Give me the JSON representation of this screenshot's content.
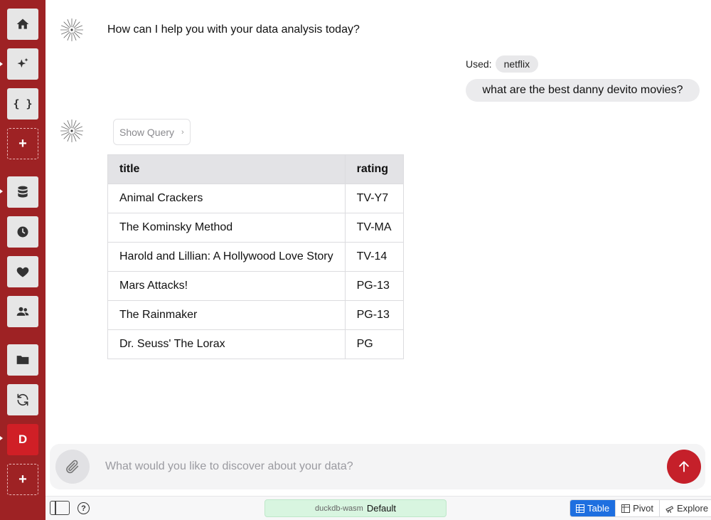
{
  "sidebar": {
    "items": [
      {
        "name": "home",
        "icon": "home-icon"
      },
      {
        "name": "ai",
        "icon": "sparkles-icon"
      },
      {
        "name": "code",
        "icon": "braces-icon",
        "glyph": "{ }"
      },
      {
        "name": "add-top",
        "icon": "plus-icon",
        "glyph": "+"
      },
      {
        "name": "database",
        "icon": "database-icon"
      },
      {
        "name": "history",
        "icon": "clock-icon"
      },
      {
        "name": "favorites",
        "icon": "heart-icon"
      },
      {
        "name": "team",
        "icon": "users-icon"
      },
      {
        "name": "files",
        "icon": "folder-icon"
      },
      {
        "name": "sync",
        "icon": "refresh-icon"
      },
      {
        "name": "default-db",
        "icon": "database-letter",
        "glyph": "D"
      },
      {
        "name": "add-bottom",
        "icon": "plus-icon",
        "glyph": "+"
      }
    ]
  },
  "chat": {
    "assistant_greeting": "How can I help you with your data analysis today?",
    "used_label": "Used:",
    "used_dataset": "netflix",
    "user_message": "what are the best danny devito movies?",
    "show_query_label": "Show Query",
    "show_query_chevron": "›",
    "results": {
      "columns": [
        "title",
        "rating"
      ],
      "rows": [
        [
          "Animal Crackers",
          "TV-Y7"
        ],
        [
          "The Kominsky Method",
          "TV-MA"
        ],
        [
          "Harold and Lillian: A Hollywood Love Story",
          "TV-14"
        ],
        [
          "Mars Attacks!",
          "PG-13"
        ],
        [
          "The Rainmaker",
          "PG-13"
        ],
        [
          "Dr. Seuss' The Lorax",
          "PG"
        ]
      ]
    }
  },
  "composer": {
    "placeholder": "What would you like to discover about your data?",
    "value": ""
  },
  "bottombar": {
    "help_glyph": "?",
    "engine": "duckdb-wasm",
    "database": "Default",
    "views": [
      "Table",
      "Pivot",
      "Explore"
    ],
    "active_view": "Table"
  },
  "colors": {
    "sidebar": "#9e2224",
    "accent_red": "#c5202a",
    "active_blue": "#1e6fe0",
    "db_pill": "#d8f5e0"
  }
}
